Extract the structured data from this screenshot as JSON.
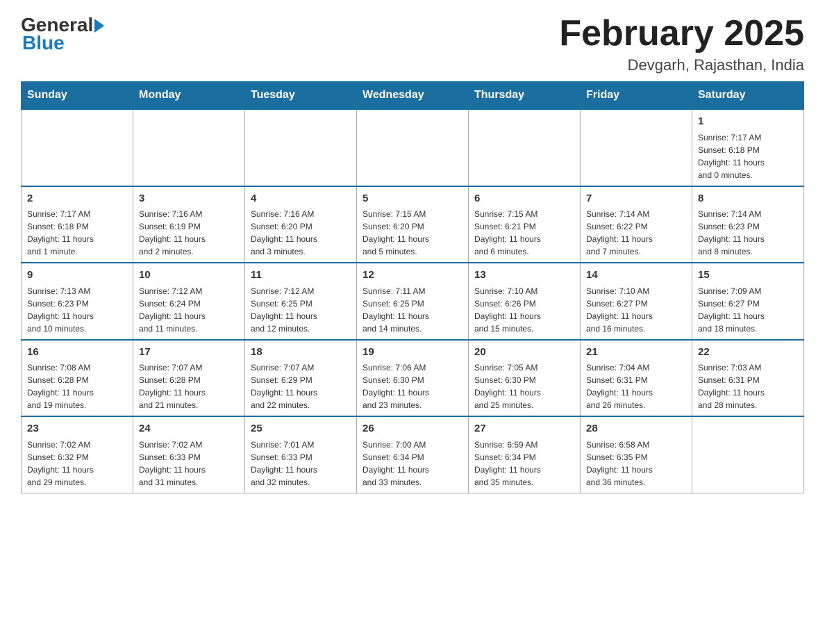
{
  "logo": {
    "general": "General",
    "blue": "Blue"
  },
  "header": {
    "title": "February 2025",
    "subtitle": "Devgarh, Rajasthan, India"
  },
  "weekdays": [
    "Sunday",
    "Monday",
    "Tuesday",
    "Wednesday",
    "Thursday",
    "Friday",
    "Saturday"
  ],
  "weeks": [
    [
      {
        "day": "",
        "info": ""
      },
      {
        "day": "",
        "info": ""
      },
      {
        "day": "",
        "info": ""
      },
      {
        "day": "",
        "info": ""
      },
      {
        "day": "",
        "info": ""
      },
      {
        "day": "",
        "info": ""
      },
      {
        "day": "1",
        "info": "Sunrise: 7:17 AM\nSunset: 6:18 PM\nDaylight: 11 hours\nand 0 minutes."
      }
    ],
    [
      {
        "day": "2",
        "info": "Sunrise: 7:17 AM\nSunset: 6:18 PM\nDaylight: 11 hours\nand 1 minute."
      },
      {
        "day": "3",
        "info": "Sunrise: 7:16 AM\nSunset: 6:19 PM\nDaylight: 11 hours\nand 2 minutes."
      },
      {
        "day": "4",
        "info": "Sunrise: 7:16 AM\nSunset: 6:20 PM\nDaylight: 11 hours\nand 3 minutes."
      },
      {
        "day": "5",
        "info": "Sunrise: 7:15 AM\nSunset: 6:20 PM\nDaylight: 11 hours\nand 5 minutes."
      },
      {
        "day": "6",
        "info": "Sunrise: 7:15 AM\nSunset: 6:21 PM\nDaylight: 11 hours\nand 6 minutes."
      },
      {
        "day": "7",
        "info": "Sunrise: 7:14 AM\nSunset: 6:22 PM\nDaylight: 11 hours\nand 7 minutes."
      },
      {
        "day": "8",
        "info": "Sunrise: 7:14 AM\nSunset: 6:23 PM\nDaylight: 11 hours\nand 8 minutes."
      }
    ],
    [
      {
        "day": "9",
        "info": "Sunrise: 7:13 AM\nSunset: 6:23 PM\nDaylight: 11 hours\nand 10 minutes."
      },
      {
        "day": "10",
        "info": "Sunrise: 7:12 AM\nSunset: 6:24 PM\nDaylight: 11 hours\nand 11 minutes."
      },
      {
        "day": "11",
        "info": "Sunrise: 7:12 AM\nSunset: 6:25 PM\nDaylight: 11 hours\nand 12 minutes."
      },
      {
        "day": "12",
        "info": "Sunrise: 7:11 AM\nSunset: 6:25 PM\nDaylight: 11 hours\nand 14 minutes."
      },
      {
        "day": "13",
        "info": "Sunrise: 7:10 AM\nSunset: 6:26 PM\nDaylight: 11 hours\nand 15 minutes."
      },
      {
        "day": "14",
        "info": "Sunrise: 7:10 AM\nSunset: 6:27 PM\nDaylight: 11 hours\nand 16 minutes."
      },
      {
        "day": "15",
        "info": "Sunrise: 7:09 AM\nSunset: 6:27 PM\nDaylight: 11 hours\nand 18 minutes."
      }
    ],
    [
      {
        "day": "16",
        "info": "Sunrise: 7:08 AM\nSunset: 6:28 PM\nDaylight: 11 hours\nand 19 minutes."
      },
      {
        "day": "17",
        "info": "Sunrise: 7:07 AM\nSunset: 6:28 PM\nDaylight: 11 hours\nand 21 minutes."
      },
      {
        "day": "18",
        "info": "Sunrise: 7:07 AM\nSunset: 6:29 PM\nDaylight: 11 hours\nand 22 minutes."
      },
      {
        "day": "19",
        "info": "Sunrise: 7:06 AM\nSunset: 6:30 PM\nDaylight: 11 hours\nand 23 minutes."
      },
      {
        "day": "20",
        "info": "Sunrise: 7:05 AM\nSunset: 6:30 PM\nDaylight: 11 hours\nand 25 minutes."
      },
      {
        "day": "21",
        "info": "Sunrise: 7:04 AM\nSunset: 6:31 PM\nDaylight: 11 hours\nand 26 minutes."
      },
      {
        "day": "22",
        "info": "Sunrise: 7:03 AM\nSunset: 6:31 PM\nDaylight: 11 hours\nand 28 minutes."
      }
    ],
    [
      {
        "day": "23",
        "info": "Sunrise: 7:02 AM\nSunset: 6:32 PM\nDaylight: 11 hours\nand 29 minutes."
      },
      {
        "day": "24",
        "info": "Sunrise: 7:02 AM\nSunset: 6:33 PM\nDaylight: 11 hours\nand 31 minutes."
      },
      {
        "day": "25",
        "info": "Sunrise: 7:01 AM\nSunset: 6:33 PM\nDaylight: 11 hours\nand 32 minutes."
      },
      {
        "day": "26",
        "info": "Sunrise: 7:00 AM\nSunset: 6:34 PM\nDaylight: 11 hours\nand 33 minutes."
      },
      {
        "day": "27",
        "info": "Sunrise: 6:59 AM\nSunset: 6:34 PM\nDaylight: 11 hours\nand 35 minutes."
      },
      {
        "day": "28",
        "info": "Sunrise: 6:58 AM\nSunset: 6:35 PM\nDaylight: 11 hours\nand 36 minutes."
      },
      {
        "day": "",
        "info": ""
      }
    ]
  ]
}
